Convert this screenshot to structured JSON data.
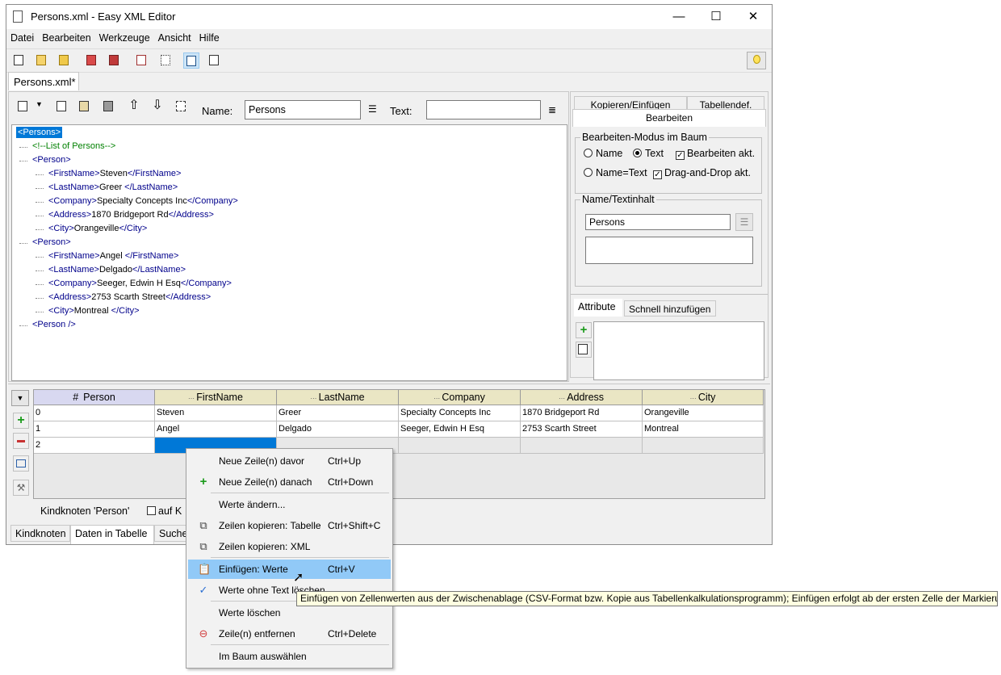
{
  "window": {
    "title": "Persons.xml - Easy XML Editor",
    "minimize_glyph": "—",
    "maximize_glyph": "☐",
    "close_glyph": "✕"
  },
  "menu": [
    "Datei",
    "Bearbeiten",
    "Werkzeuge",
    "Ansicht",
    "Hilfe"
  ],
  "file_tab": "Persons.xml*",
  "editor_toolbar": {
    "name_label": "Name:",
    "name_value": "Persons",
    "text_label": "Text:",
    "text_value": ""
  },
  "tree": [
    {
      "indent": 0,
      "parts": [
        {
          "t": "<Persons>",
          "c": "sel"
        }
      ]
    },
    {
      "indent": 1,
      "parts": [
        {
          "t": "<!--List of Persons-->",
          "c": "cm"
        }
      ]
    },
    {
      "indent": 1,
      "parts": [
        {
          "t": "<Person>",
          "c": "tag"
        }
      ]
    },
    {
      "indent": 2,
      "parts": [
        {
          "t": "<FirstName>",
          "c": "tag"
        },
        {
          "t": "Steven",
          "c": ""
        },
        {
          "t": "</FirstName>",
          "c": "tag"
        }
      ]
    },
    {
      "indent": 2,
      "parts": [
        {
          "t": "<LastName>",
          "c": "tag"
        },
        {
          "t": "Greer ",
          "c": ""
        },
        {
          "t": "</LastName>",
          "c": "tag"
        }
      ]
    },
    {
      "indent": 2,
      "parts": [
        {
          "t": "<Company>",
          "c": "tag"
        },
        {
          "t": "Specialty Concepts Inc",
          "c": ""
        },
        {
          "t": "</Company>",
          "c": "tag"
        }
      ]
    },
    {
      "indent": 2,
      "parts": [
        {
          "t": "<Address>",
          "c": "tag"
        },
        {
          "t": "1870 Bridgeport Rd",
          "c": ""
        },
        {
          "t": "</Address>",
          "c": "tag"
        }
      ]
    },
    {
      "indent": 2,
      "parts": [
        {
          "t": "<City>",
          "c": "tag"
        },
        {
          "t": "Orangeville",
          "c": ""
        },
        {
          "t": "</City>",
          "c": "tag"
        }
      ]
    },
    {
      "indent": 1,
      "parts": [
        {
          "t": "<Person>",
          "c": "tag"
        }
      ]
    },
    {
      "indent": 2,
      "parts": [
        {
          "t": "<FirstName>",
          "c": "tag"
        },
        {
          "t": "Angel ",
          "c": ""
        },
        {
          "t": "</FirstName>",
          "c": "tag"
        }
      ]
    },
    {
      "indent": 2,
      "parts": [
        {
          "t": "<LastName>",
          "c": "tag"
        },
        {
          "t": "Delgado",
          "c": ""
        },
        {
          "t": "</LastName>",
          "c": "tag"
        }
      ]
    },
    {
      "indent": 2,
      "parts": [
        {
          "t": "<Company>",
          "c": "tag"
        },
        {
          "t": "Seeger, Edwin H Esq",
          "c": ""
        },
        {
          "t": "</Company>",
          "c": "tag"
        }
      ]
    },
    {
      "indent": 2,
      "parts": [
        {
          "t": "<Address>",
          "c": "tag"
        },
        {
          "t": "2753 Scarth Street",
          "c": ""
        },
        {
          "t": "</Address>",
          "c": "tag"
        }
      ]
    },
    {
      "indent": 2,
      "parts": [
        {
          "t": "<City>",
          "c": "tag"
        },
        {
          "t": "Montreal ",
          "c": ""
        },
        {
          "t": "</City>",
          "c": "tag"
        }
      ]
    },
    {
      "indent": 1,
      "parts": [
        {
          "t": "<Person />",
          "c": "tag"
        }
      ]
    }
  ],
  "right_panel": {
    "tabs": [
      "Kopieren/Einfügen",
      "Tabellendef.",
      "Bearbeiten"
    ],
    "mode_group": "Bearbeiten-Modus im Baum",
    "radio_name": "Name",
    "radio_text": "Text",
    "chk_edit": "Bearbeiten akt.",
    "radio_name_text": "Name=Text",
    "chk_dnd": "Drag-and-Drop akt.",
    "content_group": "Name/Textinhalt",
    "content_value": "Persons",
    "attr_tabs": [
      "Attribute",
      "Schnell hinzufügen"
    ]
  },
  "grid": {
    "hash": "#",
    "columns": [
      "Person",
      "FirstName",
      "LastName",
      "Company",
      "Address",
      "City"
    ],
    "rows": [
      [
        "0",
        "Steven",
        "Greer",
        "Specialty Concepts Inc",
        "1870 Bridgeport Rd",
        "Orangeville"
      ],
      [
        "1",
        "Angel",
        "Delgado",
        "Seeger, Edwin H Esq",
        "2753 Scarth Street",
        "Montreal"
      ],
      [
        "2",
        "",
        "",
        "",
        "",
        ""
      ]
    ],
    "child_label": "Kindknoten 'Person'",
    "checkbox_label": "auf K"
  },
  "bottom_tabs": [
    "Kindknoten",
    "Daten in Tabelle",
    "Suche"
  ],
  "context_menu": [
    {
      "label": "Neue Zeile(n) davor",
      "shortcut": "Ctrl+Up",
      "icon": ""
    },
    {
      "label": "Neue Zeile(n) danach",
      "shortcut": "Ctrl+Down",
      "icon": "+"
    },
    {
      "label": "Werte ändern...",
      "shortcut": "",
      "icon": ""
    },
    {
      "label": "Zeilen kopieren: Tabelle",
      "shortcut": "Ctrl+Shift+C",
      "icon": "⧉"
    },
    {
      "label": "Zeilen kopieren: XML",
      "shortcut": "",
      "icon": "⧉"
    },
    {
      "label": "Einfügen: Werte",
      "shortcut": "Ctrl+V",
      "icon": "📋"
    },
    {
      "label": "Werte ohne Text löschen",
      "shortcut": "",
      "icon": "✓"
    },
    {
      "label": "Werte löschen",
      "shortcut": "",
      "icon": ""
    },
    {
      "label": "Zeile(n) entfernen",
      "shortcut": "Ctrl+Delete",
      "icon": "⊖"
    },
    {
      "label": "Im Baum auswählen",
      "shortcut": "",
      "icon": ""
    }
  ],
  "tooltip": "Einfügen von Zellenwerten aus der Zwischenablage (CSV-Format bzw. Kopie aus Tabellenkalkulationsprogramm); Einfügen erfolgt ab der ersten Zelle der Markierung"
}
